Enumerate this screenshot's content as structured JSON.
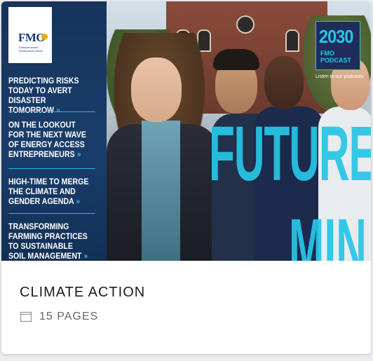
{
  "cover": {
    "logo": {
      "brand": "FMO",
      "subtitle": "Entrepreneurial Development Bank"
    },
    "headlines": [
      "Predicting risks today to avert disaster tomorrow",
      "On the lookout for the next wave of energy access entrepreneurs",
      "High-time to merge the climate and gender agenda",
      "Transforming farming practices to sustainable soil management"
    ],
    "chevron": "»",
    "feature_word": "FUTURE",
    "feature_word_2": "MIN",
    "podcast": {
      "year": "2030",
      "name": "FMO PODCAST",
      "cta": "Listen to our podcasts"
    },
    "accent_color": "#27c6e6",
    "panel_color": "#1a3d6b"
  },
  "card": {
    "title": "CLIMATE ACTION",
    "pages_label": "15 PAGES",
    "pages_icon": "book-icon"
  }
}
